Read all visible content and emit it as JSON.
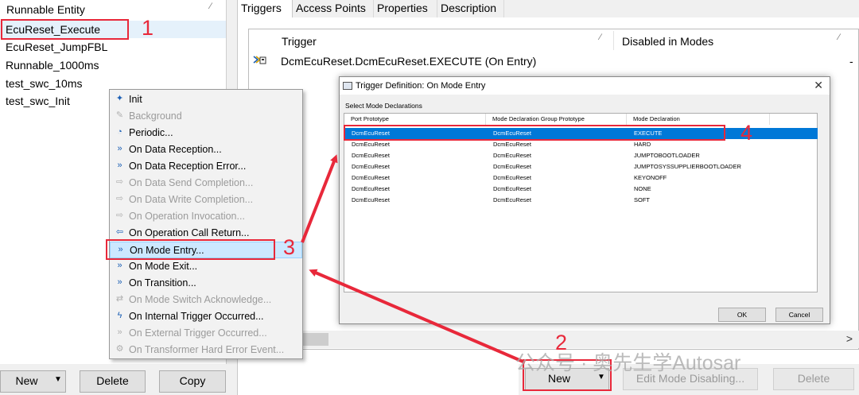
{
  "left_panel": {
    "header": "Runnable Entity",
    "items": [
      {
        "label": "EcuReset_Execute",
        "selected": true
      },
      {
        "label": "EcuReset_JumpFBL"
      },
      {
        "label": "Runnable_1000ms"
      },
      {
        "label": "test_swc_10ms"
      },
      {
        "label": "test_swc_Init"
      }
    ],
    "buttons": {
      "new": "New",
      "delete": "Delete",
      "copy": "Copy"
    }
  },
  "tabs": [
    {
      "label": "Triggers",
      "active": true
    },
    {
      "label": "Access Points"
    },
    {
      "label": "Properties"
    },
    {
      "label": "Description"
    }
  ],
  "triggers": {
    "columns": [
      "Trigger",
      "Disabled in Modes"
    ],
    "rows": [
      {
        "trigger": "DcmEcuReset.DcmEcuReset.EXECUTE (On Entry)",
        "disabled": "-"
      }
    ],
    "buttons": {
      "new": "New",
      "edit": "Edit Mode Disabling...",
      "delete": "Delete"
    }
  },
  "context_menu": {
    "items": [
      {
        "label": "Init",
        "icon": "init-icon",
        "disabled": false
      },
      {
        "label": "Background",
        "icon": "background-icon",
        "disabled": true
      },
      {
        "label": "Periodic...",
        "icon": "periodic-icon",
        "disabled": false
      },
      {
        "label": "On Data Reception...",
        "icon": "data-reception-icon",
        "disabled": false
      },
      {
        "label": "On Data Reception Error...",
        "icon": "data-reception-error-icon",
        "disabled": false
      },
      {
        "label": "On Data Send Completion...",
        "icon": "data-send-icon",
        "disabled": true
      },
      {
        "label": "On Data Write Completion...",
        "icon": "data-write-icon",
        "disabled": true
      },
      {
        "label": "On Operation Invocation...",
        "icon": "operation-invocation-icon",
        "disabled": true
      },
      {
        "label": "On Operation Call Return...",
        "icon": "operation-return-icon",
        "disabled": false
      },
      {
        "label": "On Mode Entry...",
        "icon": "mode-entry-icon",
        "disabled": false,
        "highlighted": true
      },
      {
        "label": "On Mode Exit...",
        "icon": "mode-exit-icon",
        "disabled": false
      },
      {
        "label": "On Transition...",
        "icon": "transition-icon",
        "disabled": false
      },
      {
        "label": "On Mode Switch Acknowledge...",
        "icon": "mode-switch-ack-icon",
        "disabled": true
      },
      {
        "label": "On Internal Trigger Occurred...",
        "icon": "internal-trigger-icon",
        "disabled": false
      },
      {
        "label": "On External Trigger Occurred...",
        "icon": "external-trigger-icon",
        "disabled": true
      },
      {
        "label": "On Transformer Hard Error Event...",
        "icon": "transformer-error-icon",
        "disabled": true
      }
    ]
  },
  "dialog": {
    "title": "Trigger Definition: On Mode Entry",
    "group_label": "Select Mode Declarations",
    "columns": [
      "Port Prototype",
      "Mode Declaration Group Prototype",
      "Mode Declaration"
    ],
    "rows": [
      {
        "port": "DcmEcuReset",
        "group": "DcmEcuReset",
        "mode": "EXECUTE",
        "selected": true
      },
      {
        "port": "DcmEcuReset",
        "group": "DcmEcuReset",
        "mode": "HARD"
      },
      {
        "port": "DcmEcuReset",
        "group": "DcmEcuReset",
        "mode": "JUMPTOBOOTLOADER"
      },
      {
        "port": "DcmEcuReset",
        "group": "DcmEcuReset",
        "mode": "JUMPTOSYSSUPPLIERBOOTLOADER"
      },
      {
        "port": "DcmEcuReset",
        "group": "DcmEcuReset",
        "mode": "KEYONOFF"
      },
      {
        "port": "DcmEcuReset",
        "group": "DcmEcuReset",
        "mode": "NONE"
      },
      {
        "port": "DcmEcuReset",
        "group": "DcmEcuReset",
        "mode": "SOFT"
      }
    ],
    "buttons": {
      "ok": "OK",
      "cancel": "Cancel"
    }
  },
  "annotations": {
    "n1": "1",
    "n2": "2",
    "n3": "3",
    "n4": "4",
    "color": "#e8283a"
  },
  "watermark": "公众号 · 奥先生学Autosar"
}
